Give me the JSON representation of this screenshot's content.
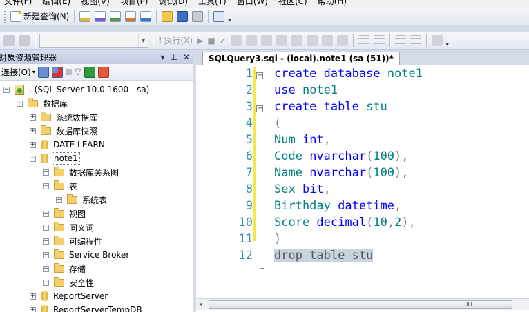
{
  "menu": [
    "文件(F)",
    "编辑(E)",
    "视图(V)",
    "项目(P)",
    "调试(D)",
    "工具(T)",
    "窗口(W)",
    "社区(C)",
    "帮助(H)"
  ],
  "toolbar": {
    "new_query_label": "新建查询(N)",
    "execute_label": "执行(X)",
    "database_selected": ""
  },
  "object_explorer": {
    "title": "对象资源管理器",
    "connect_label": "连接(O)",
    "tree": [
      {
        "label": ". (SQL Server 10.0.1600 - sa)",
        "level": 0,
        "expander": "-",
        "icon": "server-icon"
      },
      {
        "label": "数据库",
        "level": 1,
        "expander": "-",
        "icon": "folder-icon"
      },
      {
        "label": "系统数据库",
        "level": 2,
        "expander": "+",
        "icon": "folder-icon"
      },
      {
        "label": "数据库快照",
        "level": 2,
        "expander": "+",
        "icon": "folder-icon"
      },
      {
        "label": "DATE LEARN",
        "level": 2,
        "expander": "+",
        "icon": "database-icon"
      },
      {
        "label": "note1",
        "level": 2,
        "expander": "-",
        "icon": "database-icon",
        "selected": true
      },
      {
        "label": "数据库关系图",
        "level": 3,
        "expander": "+",
        "icon": "folder-icon"
      },
      {
        "label": "表",
        "level": 3,
        "expander": "-",
        "icon": "folder-icon"
      },
      {
        "label": "系统表",
        "level": 4,
        "expander": "+",
        "icon": "folder-icon"
      },
      {
        "label": "视图",
        "level": 3,
        "expander": "+",
        "icon": "folder-icon"
      },
      {
        "label": "同义词",
        "level": 3,
        "expander": "+",
        "icon": "folder-icon"
      },
      {
        "label": "可编程性",
        "level": 3,
        "expander": "+",
        "icon": "folder-icon"
      },
      {
        "label": "Service Broker",
        "level": 3,
        "expander": "+",
        "icon": "folder-icon"
      },
      {
        "label": "存储",
        "level": 3,
        "expander": "+",
        "icon": "folder-icon"
      },
      {
        "label": "安全性",
        "level": 3,
        "expander": "+",
        "icon": "folder-icon"
      },
      {
        "label": "ReportServer",
        "level": 2,
        "expander": "+",
        "icon": "database-icon"
      },
      {
        "label": "ReportServerTempDB",
        "level": 2,
        "expander": "+",
        "icon": "database-icon"
      }
    ]
  },
  "editor": {
    "tab_title": "SQLQuery3.sql - (local).note1 (sa (51))*",
    "lines": [
      {
        "n": "1",
        "tokens": [
          [
            "kw",
            "create database "
          ],
          [
            "id",
            "note1"
          ]
        ]
      },
      {
        "n": "2",
        "tokens": [
          [
            "kw",
            "use "
          ],
          [
            "id",
            "note1"
          ]
        ]
      },
      {
        "n": "3",
        "tokens": [
          [
            "kw",
            "create table "
          ],
          [
            "id",
            "stu"
          ]
        ]
      },
      {
        "n": "4",
        "tokens": [
          [
            "pn",
            "("
          ]
        ]
      },
      {
        "n": "5",
        "tokens": [
          [
            "id",
            "Num "
          ],
          [
            "kw",
            "int"
          ],
          [
            "pn",
            ","
          ]
        ]
      },
      {
        "n": "6",
        "tokens": [
          [
            "id",
            "Code "
          ],
          [
            "kw",
            "nvarchar"
          ],
          [
            "pn",
            "("
          ],
          [
            "id",
            "100"
          ],
          [
            "pn",
            "),"
          ]
        ]
      },
      {
        "n": "7",
        "tokens": [
          [
            "id",
            "Name "
          ],
          [
            "kw",
            "nvarchar"
          ],
          [
            "pn",
            "("
          ],
          [
            "id",
            "100"
          ],
          [
            "pn",
            "),"
          ]
        ]
      },
      {
        "n": "8",
        "tokens": [
          [
            "id",
            "Sex "
          ],
          [
            "kw",
            "bit"
          ],
          [
            "pn",
            ","
          ]
        ]
      },
      {
        "n": "9",
        "tokens": [
          [
            "id",
            "Birthday "
          ],
          [
            "kw",
            "datetime"
          ],
          [
            "pn",
            ","
          ]
        ]
      },
      {
        "n": "10",
        "tokens": [
          [
            "id",
            "Score "
          ],
          [
            "kw",
            "decimal"
          ],
          [
            "pn",
            "("
          ],
          [
            "id",
            "10"
          ],
          [
            "pn",
            ","
          ],
          [
            "id",
            "2"
          ],
          [
            "pn",
            "),"
          ]
        ]
      },
      {
        "n": "11",
        "tokens": [
          [
            "pn",
            ")"
          ]
        ]
      },
      {
        "n": "12",
        "tokens": [
          [
            "hl",
            "drop table stu"
          ]
        ]
      }
    ]
  },
  "colors": {
    "keyword": "#0000ff",
    "identifier": "#008080",
    "punct": "#808080",
    "line_number": "#2b91af",
    "selection": "#c9d3dd",
    "change_margin": "#f3e84a"
  }
}
